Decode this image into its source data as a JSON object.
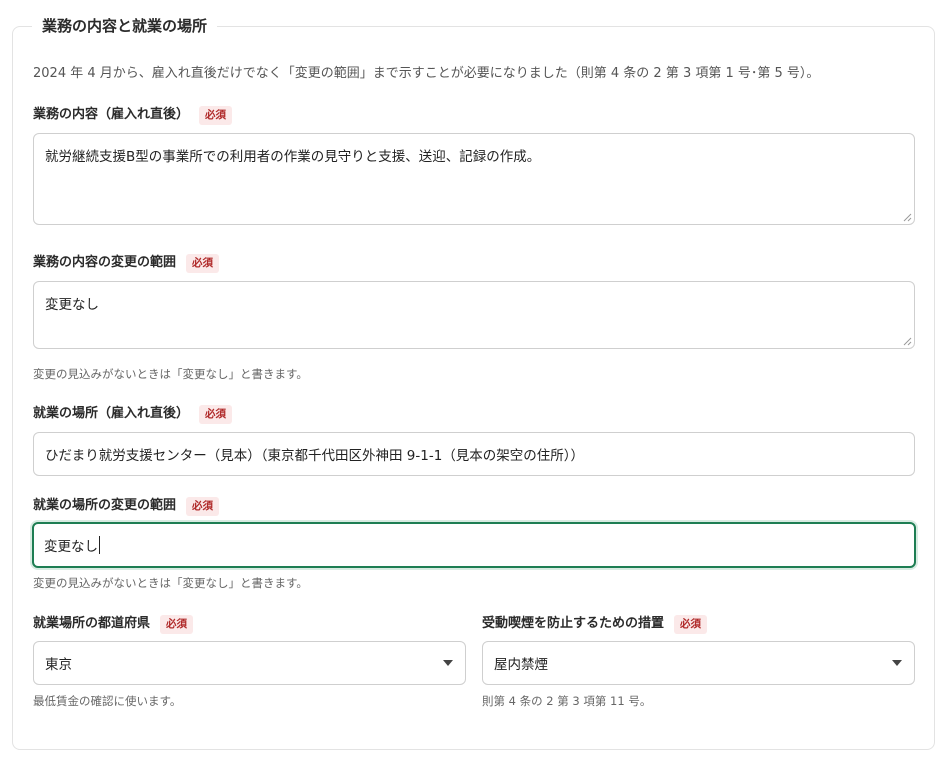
{
  "section": {
    "title": "業務の内容と就業の場所",
    "intro": "2024 年 4 月から、雇入れ直後だけでなく「変更の範囲」まで示すことが必要になりました（則第 4 条の 2 第 3 項第 1 号･第 5 号）。"
  },
  "required_badge": "必須",
  "duties_initial": {
    "label": "業務の内容（雇入れ直後）",
    "value": "就労継続支援B型の事業所での利用者の作業の見守りと支援、送迎、記録の作成。"
  },
  "duties_change": {
    "label": "業務の内容の変更の範囲",
    "value": "変更なし",
    "hint": "変更の見込みがないときは「変更なし」と書きます。"
  },
  "place_initial": {
    "label": "就業の場所（雇入れ直後）",
    "value": "ひだまり就労支援センター（見本）（東京都千代田区外神田 9-1-1（見本の架空の住所））"
  },
  "place_change": {
    "label": "就業の場所の変更の範囲",
    "value": "変更なし",
    "hint": "変更の見込みがないときは「変更なし」と書きます。"
  },
  "prefecture": {
    "label": "就業場所の都道府県",
    "value": "東京",
    "hint": "最低賃金の確認に使います。"
  },
  "smoking": {
    "label": "受動喫煙を防止するための措置",
    "value": "屋内禁煙",
    "hint": "則第 4 条の 2 第 3 項第 11 号。"
  }
}
